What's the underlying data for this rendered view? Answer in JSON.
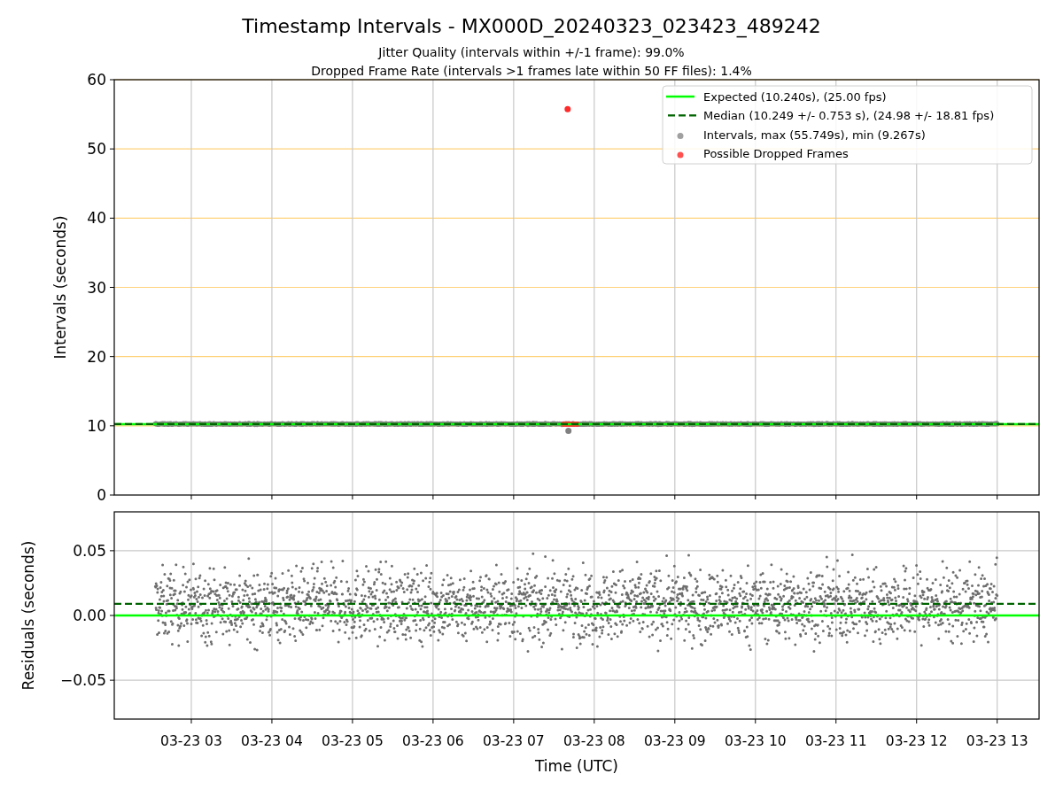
{
  "intervals_panel": {
    "subtitles": [
      "Jitter Quality (intervals within +/-1 frame): 99.0%",
      "Dropped Frame Rate (intervals >1 frames late within 50 FF files): 1.4%"
    ],
    "chart_data": {
      "type": "scatter",
      "title": "Timestamp Intervals - MX000D_20240323_023423_489242",
      "ylabel": "Intervals (seconds)",
      "categories": [
        null,
        null,
        null,
        null,
        null,
        null,
        null,
        null,
        null,
        null,
        null
      ],
      "ylim": [
        0,
        60
      ],
      "yticks": [
        0,
        10,
        20,
        30,
        40,
        50,
        60
      ],
      "grid": true,
      "ref_lines": [
        {
          "axis": "y",
          "value": 10.24,
          "color": "#00ff00"
        },
        {
          "axis": "y",
          "value": 10.249,
          "color": "#006400"
        }
      ]
    },
    "legend": [
      {
        "label": "Expected (10.240s), (25.00 fps)",
        "kind": "line",
        "color": "#00ff00"
      },
      {
        "label": "Median (10.249 +/- 0.753 s), (24.98 +/- 18.81 fps)",
        "kind": "dashed_line",
        "color": "#006400"
      },
      {
        "label": "Intervals, max (55.749s), min (9.267s)",
        "kind": "points",
        "color": "#a0a0a0"
      },
      {
        "label": "Possible Dropped Frames",
        "kind": "points",
        "color": "#ff5050"
      }
    ]
  },
  "residuals_panel": {
    "chart_data": {
      "type": "scatter",
      "xlabel": "Time (UTC)",
      "ylabel": "Residuals (seconds)",
      "categories": [
        "03-23 03",
        "03-23 04",
        "03-23 05",
        "03-23 06",
        "03-23 07",
        "03-23 08",
        "03-23 09",
        "03-23 10",
        "03-23 11",
        "03-23 12",
        "03-23 13"
      ],
      "ylim": [
        -0.08,
        0.08
      ],
      "yticks": [
        {
          "value": -0.05,
          "label": "−0.05"
        },
        {
          "value": 0,
          "label": "0.00"
        },
        {
          "value": 0.05,
          "label": "0.05"
        }
      ],
      "grid": true,
      "ref_lines": [
        {
          "axis": "y",
          "value": 0,
          "color": "#00ff00"
        },
        {
          "axis": "y",
          "value": 0.009,
          "color": "#006400"
        }
      ]
    }
  }
}
